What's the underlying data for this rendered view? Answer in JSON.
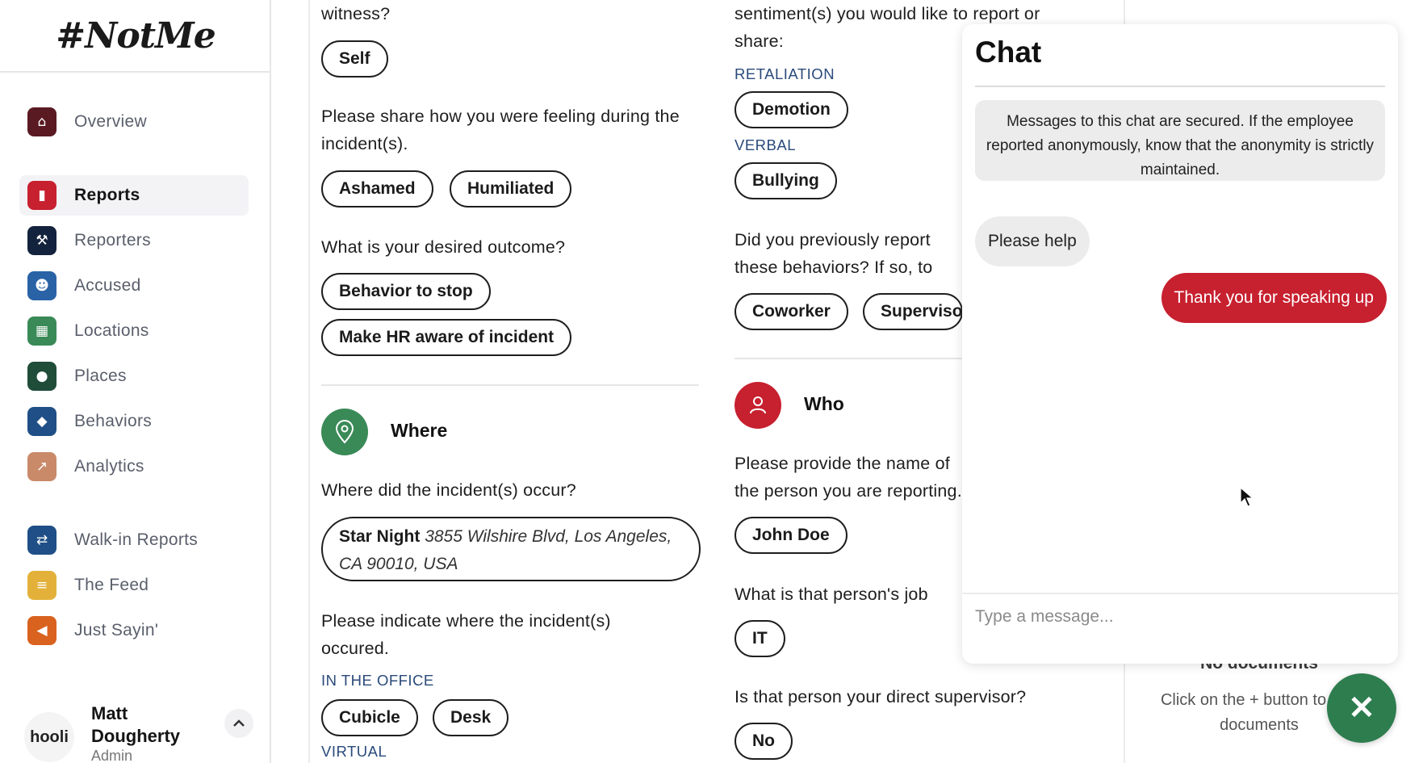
{
  "app": {
    "logo": "#NotMe"
  },
  "sidebar": {
    "items": [
      {
        "label": "Overview",
        "icon": "home-icon",
        "color": "#5a1a22",
        "glyph": "⌂"
      },
      {
        "label": "Reports",
        "icon": "clipboard-icon",
        "color": "#c7202f",
        "glyph": "▮"
      },
      {
        "label": "Reporters",
        "icon": "gavel-icon",
        "color": "#14233d",
        "glyph": "⚒"
      },
      {
        "label": "Accused",
        "icon": "users-icon",
        "color": "#2a62a6",
        "glyph": "☻"
      },
      {
        "label": "Locations",
        "icon": "map-icon",
        "color": "#3a8a57",
        "glyph": "▦"
      },
      {
        "label": "Places",
        "icon": "pin-icon",
        "color": "#1f4d3a",
        "glyph": "●"
      },
      {
        "label": "Behaviors",
        "icon": "chat-bubbles-icon",
        "color": "#1f4f86",
        "glyph": "◆"
      },
      {
        "label": "Analytics",
        "icon": "chart-icon",
        "color": "#c98a6a",
        "glyph": "↗"
      },
      {
        "label": "Walk-in Reports",
        "icon": "handshake-icon",
        "color": "#1f4f86",
        "glyph": "⇄"
      },
      {
        "label": "The Feed",
        "icon": "feed-icon",
        "color": "#e3b13a",
        "glyph": "≡"
      },
      {
        "label": "Just Sayin'",
        "icon": "megaphone-icon",
        "color": "#d9621f",
        "glyph": "◀"
      }
    ],
    "user": {
      "name": "Matt Dougherty",
      "role": "Admin",
      "avatar_text": "hooli"
    }
  },
  "report": {
    "col1": {
      "witness_tail": "witness?",
      "witness_answer": "Self",
      "feeling_q": "Please share how you were feeling during the incident(s).",
      "feelings": [
        "Ashamed",
        "Humiliated"
      ],
      "outcome_q": "What is your desired outcome?",
      "outcomes": [
        "Behavior to stop",
        "Make HR aware of incident"
      ],
      "where_title": "Where",
      "where_q": "Where did the incident(s) occur?",
      "location_name": "Star Night",
      "location_address": "3855 Wilshire Blvd, Los Angeles, CA 90010, USA",
      "indicate_q": "Please indicate where the incident(s) occured.",
      "cat_office": "IN THE OFFICE",
      "office_places": [
        "Cubicle",
        "Desk"
      ],
      "cat_virtual": "VIRTUAL"
    },
    "col2": {
      "sentiment_tail": "sentiment(s) you would like to report or share:",
      "cat_retaliation": "RETALIATION",
      "retaliation": "Demotion",
      "cat_verbal": "VERBAL",
      "verbal": "Bullying",
      "prev_q": "Did you previously report these behaviors? If so, to whom?",
      "prev_answers": [
        "Coworker",
        "Supervisor"
      ],
      "who_title": "Who",
      "name_q": "Please provide the name of the person you are reporting.",
      "name_answer": "John Doe",
      "job_q": "What is that person's job title?",
      "job_answer": "IT",
      "supervisor_q": "Is that person your direct supervisor?",
      "supervisor_answer": "No"
    }
  },
  "chat": {
    "title": "Chat",
    "notice": "Messages to this chat are secured. If the employee reported anonymously, know that the anonymity is strictly maintained.",
    "incoming": "Please help",
    "outgoing": "Thank you for speaking up",
    "input_placeholder": "Type a message..."
  },
  "documents": {
    "empty_title": "No documents",
    "empty_hint": "Click on the + button to add documents"
  },
  "colors": {
    "accent_red": "#c7202f",
    "accent_green": "#2e7d4f",
    "category_blue": "#2a4a7a"
  }
}
